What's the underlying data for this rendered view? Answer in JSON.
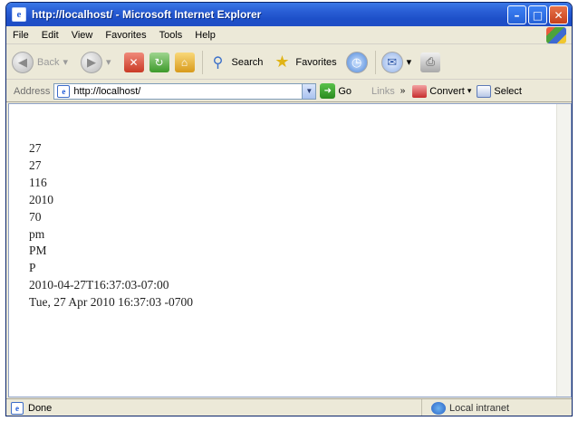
{
  "window": {
    "title": "http://localhost/ - Microsoft Internet Explorer",
    "app_icon": "ie-page-icon",
    "caption_buttons": [
      "minimize-icon",
      "maximize-icon",
      "close-icon"
    ]
  },
  "menu": {
    "items": [
      "File",
      "Edit",
      "View",
      "Favorites",
      "Tools",
      "Help"
    ]
  },
  "toolbar": {
    "back_label": "Back",
    "search_label": "Search",
    "favorites_label": "Favorites"
  },
  "address": {
    "label": "Address",
    "value": "http://localhost/",
    "go_label": "Go",
    "links_label": "Links",
    "convert_label": "Convert",
    "select_label": "Select"
  },
  "content": {
    "lines": [
      "27",
      "27",
      "116",
      "2010",
      "70",
      "pm",
      "PM",
      "P",
      "2010-04-27T16:37:03-07:00",
      "Tue, 27 Apr 2010 16:37:03 -0700"
    ]
  },
  "status": {
    "text": "Done",
    "zone": "Local intranet"
  },
  "colors": {
    "titlebar": "#2a5fd6",
    "chrome": "#ece9d8",
    "close_button": "#c6401c"
  }
}
